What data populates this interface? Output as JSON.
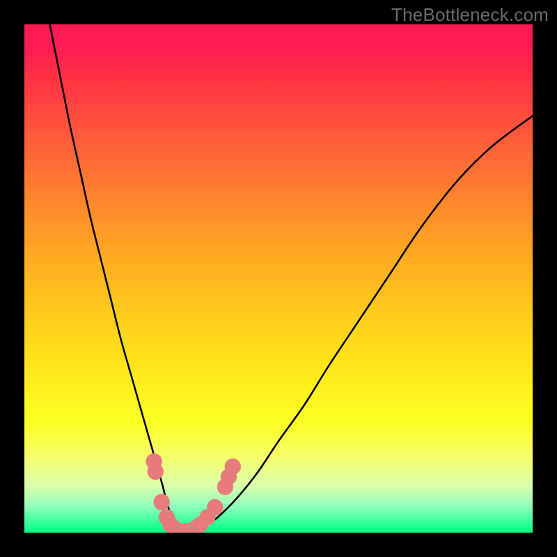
{
  "watermark": "TheBottleneck.com",
  "chart_data": {
    "type": "line",
    "title": "",
    "xlabel": "",
    "ylabel": "",
    "xlim": [
      0,
      100
    ],
    "ylim": [
      0,
      100
    ],
    "background_gradient": {
      "orientation": "vertical",
      "stops": [
        {
          "pos": 0.0,
          "color": "#ff1a53"
        },
        {
          "pos": 0.1,
          "color": "#ff3044"
        },
        {
          "pos": 0.22,
          "color": "#ff5a3a"
        },
        {
          "pos": 0.36,
          "color": "#ff8a2a"
        },
        {
          "pos": 0.5,
          "color": "#ffb81f"
        },
        {
          "pos": 0.66,
          "color": "#ffe31a"
        },
        {
          "pos": 0.78,
          "color": "#fdff22"
        },
        {
          "pos": 0.85,
          "color": "#f7ff6a"
        },
        {
          "pos": 0.91,
          "color": "#d8ffb0"
        },
        {
          "pos": 0.95,
          "color": "#8cffb8"
        },
        {
          "pos": 0.98,
          "color": "#36ff9a"
        },
        {
          "pos": 1.0,
          "color": "#00ff7f"
        }
      ]
    },
    "series": [
      {
        "name": "bottleneck-curve",
        "color": "#000000",
        "x": [
          5,
          7,
          9,
          11,
          13,
          15,
          17,
          19,
          21,
          23,
          25,
          27,
          28,
          29,
          30,
          31,
          33,
          35,
          38,
          42,
          46,
          50,
          55,
          60,
          66,
          72,
          78,
          85,
          92,
          100
        ],
        "values": [
          100,
          90,
          80,
          71,
          62,
          54,
          46,
          38,
          31,
          24,
          17,
          10,
          6,
          3,
          1,
          0,
          0,
          1,
          3,
          7,
          12,
          18,
          25,
          33,
          42,
          51,
          60,
          69,
          76,
          82
        ]
      }
    ],
    "markers": {
      "name": "highlight-points",
      "color": "#e77a7a",
      "radius": 1.6,
      "points": [
        {
          "x": 25.5,
          "y": 14
        },
        {
          "x": 25.8,
          "y": 12
        },
        {
          "x": 27.0,
          "y": 6
        },
        {
          "x": 28.0,
          "y": 3
        },
        {
          "x": 28.8,
          "y": 1.5
        },
        {
          "x": 30.0,
          "y": 0.5
        },
        {
          "x": 31.5,
          "y": 0.3
        },
        {
          "x": 33.0,
          "y": 0.5
        },
        {
          "x": 34.5,
          "y": 1.5
        },
        {
          "x": 36.0,
          "y": 3
        },
        {
          "x": 37.5,
          "y": 5
        },
        {
          "x": 39.5,
          "y": 9
        },
        {
          "x": 40.2,
          "y": 11
        },
        {
          "x": 41.0,
          "y": 13
        }
      ]
    }
  }
}
